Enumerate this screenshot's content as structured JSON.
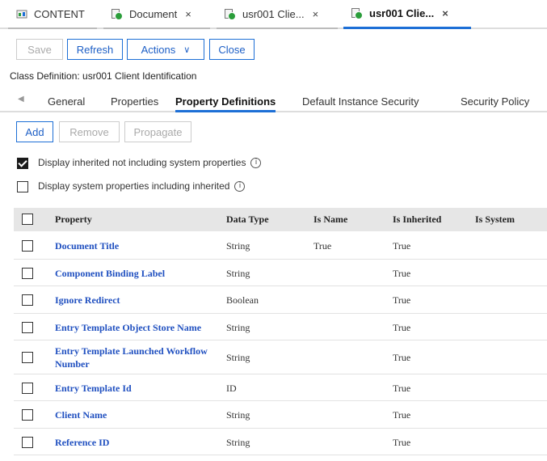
{
  "tabs": [
    {
      "label": "CONTENT",
      "closable": false,
      "active": false
    },
    {
      "label": "Document",
      "closable": true,
      "active": false
    },
    {
      "label": "usr001 Clie...",
      "closable": true,
      "active": false
    },
    {
      "label": "usr001 Clie...",
      "closable": true,
      "active": true
    }
  ],
  "toolbar": {
    "save": "Save",
    "refresh": "Refresh",
    "actions": "Actions",
    "close": "Close"
  },
  "class_definition": "Class Definition: usr001 Client Identification",
  "subtabs": [
    "General",
    "Properties",
    "Property Definitions",
    "Default Instance Security",
    "Security Policy"
  ],
  "active_subtab": "Property Definitions",
  "prop_actions": {
    "add": "Add",
    "remove": "Remove",
    "propagate": "Propagate"
  },
  "options": [
    {
      "label": "Display inherited not including system properties",
      "checked": true
    },
    {
      "label": "Display system properties including inherited",
      "checked": false
    }
  ],
  "info_glyph": "i",
  "close_glyph": "×",
  "caret_glyph": "∨",
  "left_arrow_glyph": "◀",
  "table": {
    "columns": [
      "Property",
      "Data Type",
      "Is Name",
      "Is Inherited",
      "Is System"
    ],
    "rows": [
      {
        "property": "Document Title",
        "data_type": "String",
        "is_name": "True",
        "is_inherited": "True",
        "is_system": ""
      },
      {
        "property": "Component Binding Label",
        "data_type": "String",
        "is_name": "",
        "is_inherited": "True",
        "is_system": ""
      },
      {
        "property": "Ignore Redirect",
        "data_type": "Boolean",
        "is_name": "",
        "is_inherited": "True",
        "is_system": ""
      },
      {
        "property": "Entry Template Object Store Name",
        "data_type": "String",
        "is_name": "",
        "is_inherited": "True",
        "is_system": ""
      },
      {
        "property": "Entry Template Launched Workflow Number",
        "data_type": "String",
        "is_name": "",
        "is_inherited": "True",
        "is_system": ""
      },
      {
        "property": "Entry Template Id",
        "data_type": "ID",
        "is_name": "",
        "is_inherited": "True",
        "is_system": ""
      },
      {
        "property": "Client Name",
        "data_type": "String",
        "is_name": "",
        "is_inherited": "True",
        "is_system": ""
      },
      {
        "property": "Reference ID",
        "data_type": "String",
        "is_name": "",
        "is_inherited": "True",
        "is_system": ""
      }
    ]
  },
  "colors": {
    "accent": "#1d6fd6",
    "link": "#2050c0",
    "header_bg": "#e6e6e6"
  }
}
